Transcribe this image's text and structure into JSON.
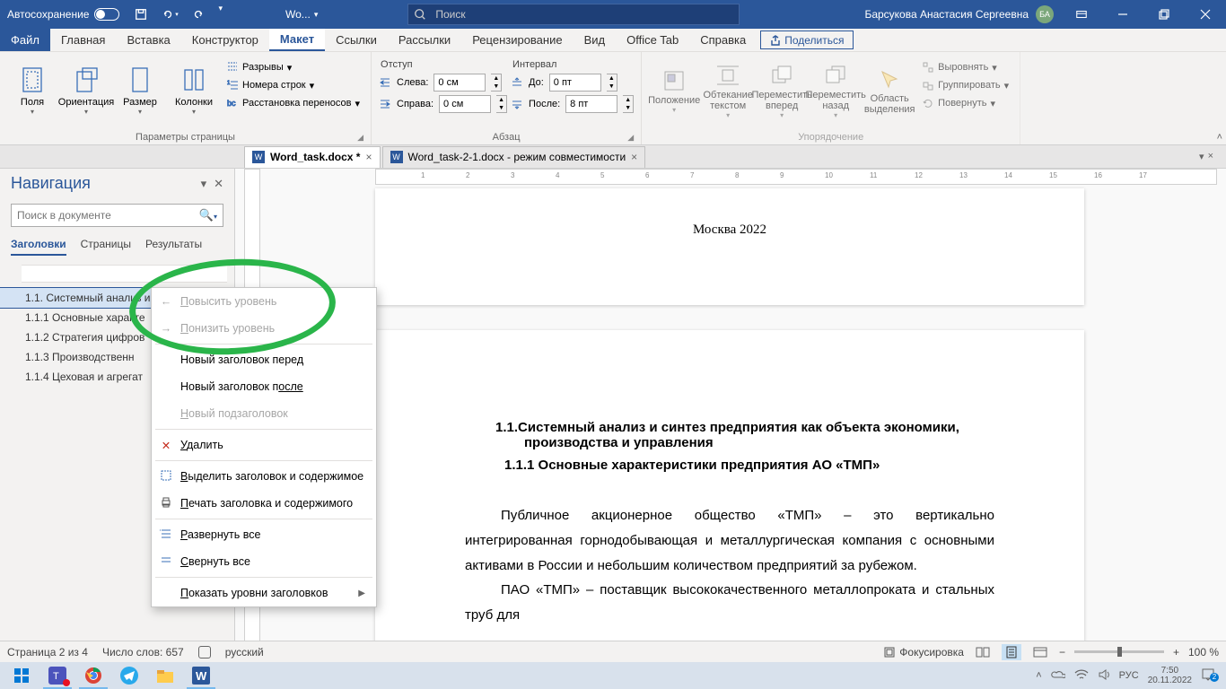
{
  "titlebar": {
    "autosave": "Автосохранение",
    "app_title": "Wo...",
    "search_placeholder": "Поиск",
    "user_name": "Барсукова Анастасия Сергеевна",
    "user_initials": "БА"
  },
  "menubar": {
    "file": "Файл",
    "home": "Главная",
    "insert": "Вставка",
    "design": "Конструктор",
    "layout": "Макет",
    "references": "Ссылки",
    "mailings": "Рассылки",
    "review": "Рецензирование",
    "view": "Вид",
    "officetab": "Office Tab",
    "help": "Справка",
    "share": "Поделиться"
  },
  "ribbon": {
    "margins": "Поля",
    "orientation": "Ориентация",
    "size": "Размер",
    "columns": "Колонки",
    "breaks": "Разрывы",
    "line_numbers": "Номера строк",
    "hyphenation": "Расстановка переносов",
    "page_setup": "Параметры страницы",
    "indent": "Отступ",
    "left": "Слева:",
    "right": "Справа:",
    "left_val": "0 см",
    "right_val": "0 см",
    "spacing": "Интервал",
    "before": "До:",
    "after": "После:",
    "before_val": "0 пт",
    "after_val": "8 пт",
    "paragraph": "Абзац",
    "position": "Положение",
    "wrap": "Обтекание текстом",
    "bring_fwd": "Переместить вперед",
    "send_back": "Переместить назад",
    "selection": "Область выделения",
    "align": "Выровнять",
    "group": "Группировать",
    "rotate": "Повернуть",
    "arrange": "Упорядочение"
  },
  "doctabs": {
    "tab1": "Word_task.docx *",
    "tab2": "Word_task-2-1.docx  -  режим совместимости"
  },
  "nav": {
    "title": "Навигация",
    "search_placeholder": "Поиск в документе",
    "tab_headings": "Заголовки",
    "tab_pages": "Страницы",
    "tab_results": "Результаты",
    "items": [
      "1.1. Системный анализ и синтез пр...",
      "1.1.1 Основные характе",
      "1.1.2 Стратегия цифров",
      "1.1.3 Производственн",
      "1.1.4 Цеховая и агрегат"
    ]
  },
  "context_menu": {
    "promote_pre": "П",
    "promote_post": "овысить уровень",
    "demote_pre": "П",
    "demote_post": "онизить уровень",
    "new_before_pre": "Новый заголовок пере",
    "new_before_post": "д",
    "new_after_pre": "Новый заголовок п",
    "new_after_post": "осле",
    "new_sub_pre": "Н",
    "new_sub_post": "овый подзаголовок",
    "delete_pre": "У",
    "delete_post": "далить",
    "select_pre": "В",
    "select_post": "ыделить заголовок и содержимое",
    "print_pre": "П",
    "print_post": "ечать заголовка и содержимого",
    "expand_pre": "Р",
    "expand_post": "азвернуть все",
    "collapse_pre": "С",
    "collapse_post": "вернуть все",
    "show_levels_pre": "П",
    "show_levels_post": "оказать уровни заголовков"
  },
  "document": {
    "page1_footer": "Москва 2022",
    "h11": "1.1.Системный анализ и синтез предприятия как объекта экономики, производства и управления",
    "h111": "1.1.1    Основные характеристики предприятия АО «ТМП»",
    "p1": "Публичное акционерное общество «ТМП» – это вертикально интегрированная горнодобывающая и металлургическая компания с основными активами в России и небольшим количеством предприятий за рубежом.",
    "p2": "ПАО «ТМП» – поставщик высококачественного металлопроката и стальных труб для"
  },
  "statusbar": {
    "page": "Страница 2 из 4",
    "words": "Число слов: 657",
    "lang": "русский",
    "focus": "Фокусировка",
    "zoom": "100 %"
  },
  "taskbar": {
    "lang": "РУС",
    "time": "7:50",
    "date": "20.11.2022"
  }
}
